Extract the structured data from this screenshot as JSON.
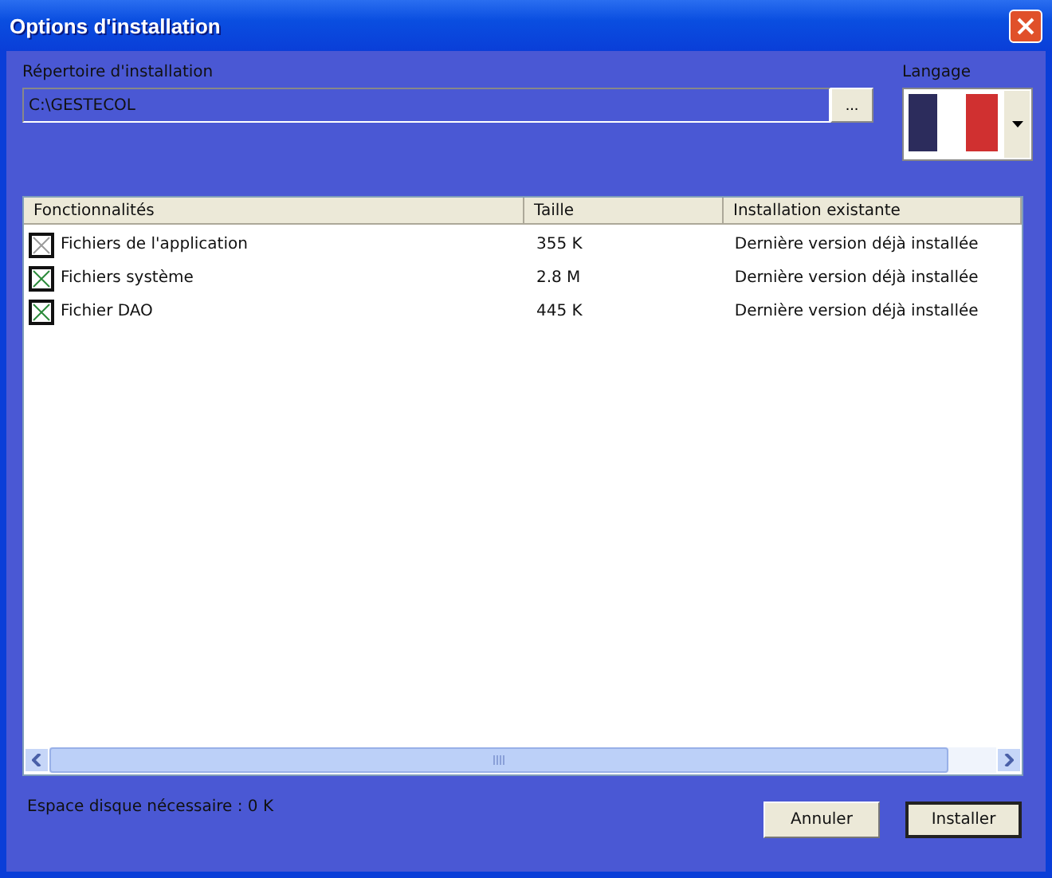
{
  "window": {
    "title": "Options d'installation"
  },
  "install_dir": {
    "label": "Répertoire d'installation",
    "value": "C:\\GESTECOL",
    "browse": "..."
  },
  "language": {
    "label": "Langage"
  },
  "table": {
    "columns": [
      "Fonctionnalités",
      "Taille",
      "Installation existante"
    ],
    "rows": [
      {
        "name": "Fichiers de l'application",
        "size": "355 K",
        "existing": "Dernière version déjà installée",
        "checked": false
      },
      {
        "name": "Fichiers système",
        "size": "2.8 M",
        "existing": "Dernière version déjà installée",
        "checked": true
      },
      {
        "name": "Fichier DAO",
        "size": "445 K",
        "existing": "Dernière version déjà installée",
        "checked": true
      }
    ]
  },
  "disk_space": "Espace disque nécessaire : 0 K",
  "buttons": [
    "Annuler",
    "Installer"
  ]
}
